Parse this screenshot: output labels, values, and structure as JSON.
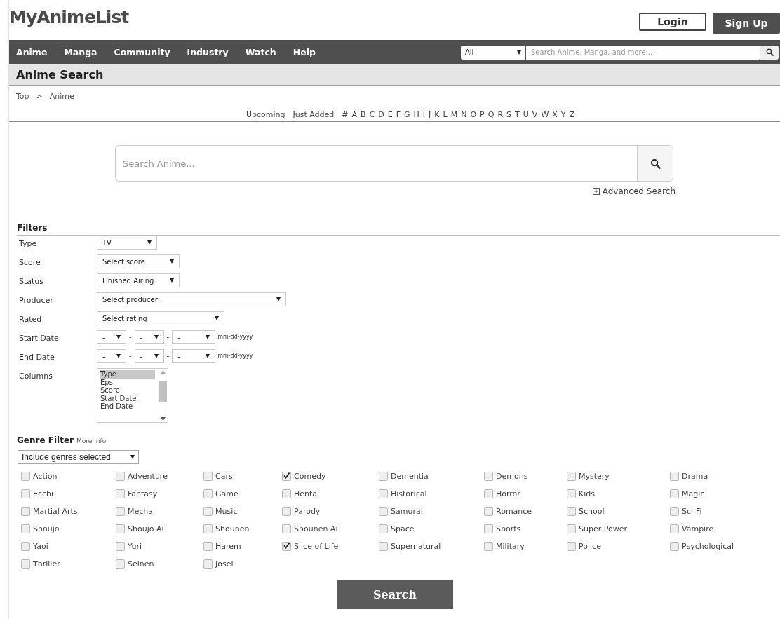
{
  "header": {
    "logo": "MyAnimeList",
    "login": "Login",
    "signup": "Sign Up"
  },
  "nav": {
    "items": [
      "Anime",
      "Manga",
      "Community",
      "Industry",
      "Watch",
      "Help"
    ],
    "search_category": "All",
    "search_placeholder": "Search Anime, Manga, and more..."
  },
  "page_title": "Anime Search",
  "breadcrumb": [
    "Top",
    ">",
    "Anime"
  ],
  "letter_links": [
    "Upcoming",
    "Just Added",
    "#",
    "A",
    "B",
    "C",
    "D",
    "E",
    "F",
    "G",
    "H",
    "I",
    "J",
    "K",
    "L",
    "M",
    "N",
    "O",
    "P",
    "Q",
    "R",
    "S",
    "T",
    "U",
    "V",
    "W",
    "X",
    "Y",
    "Z"
  ],
  "search": {
    "placeholder": "Search Anime...",
    "advanced": "Advanced Search"
  },
  "filters": {
    "title": "Filters",
    "rows": [
      {
        "kind": "select",
        "label": "Type",
        "value": "TV"
      },
      {
        "kind": "select",
        "label": "Score",
        "value": "Select score"
      },
      {
        "kind": "select",
        "label": "Status",
        "value": "Finished Airing"
      },
      {
        "kind": "select",
        "label": "Producer",
        "value": "Select producer"
      },
      {
        "kind": "select",
        "label": "Rated",
        "value": "Select rating"
      },
      {
        "kind": "date",
        "label": "Start Date",
        "parts": [
          "-",
          "-",
          "-"
        ],
        "separator": "-",
        "format": "mm-dd-yyyy"
      },
      {
        "kind": "date",
        "label": "End Date",
        "parts": [
          "-",
          "-",
          "-"
        ],
        "separator": "-",
        "format": "mm-dd-yyyy"
      },
      {
        "kind": "list",
        "label": "Columns",
        "options": [
          {
            "label": "Type",
            "selected": true
          },
          {
            "label": "Eps",
            "selected": false
          },
          {
            "label": "Score",
            "selected": false
          },
          {
            "label": "Start Date",
            "selected": false
          },
          {
            "label": "End Date",
            "selected": false
          }
        ]
      }
    ]
  },
  "genre_filter": {
    "title": "Genre Filter",
    "more_info": "More Info",
    "mode": "Include genres selected",
    "genres": [
      {
        "label": "Action",
        "checked": false
      },
      {
        "label": "Adventure",
        "checked": false
      },
      {
        "label": "Cars",
        "checked": false
      },
      {
        "label": "Comedy",
        "checked": true
      },
      {
        "label": "Dementia",
        "checked": false
      },
      {
        "label": "Demons",
        "checked": false
      },
      {
        "label": "Mystery",
        "checked": false
      },
      {
        "label": "Drama",
        "checked": false
      },
      {
        "label": "Ecchi",
        "checked": false
      },
      {
        "label": "Fantasy",
        "checked": false
      },
      {
        "label": "Game",
        "checked": false
      },
      {
        "label": "Hentai",
        "checked": false
      },
      {
        "label": "Historical",
        "checked": false
      },
      {
        "label": "Horror",
        "checked": false
      },
      {
        "label": "Kids",
        "checked": false
      },
      {
        "label": "Magic",
        "checked": false
      },
      {
        "label": "Martial Arts",
        "checked": false
      },
      {
        "label": "Mecha",
        "checked": false
      },
      {
        "label": "Music",
        "checked": false
      },
      {
        "label": "Parody",
        "checked": false
      },
      {
        "label": "Samurai",
        "checked": false
      },
      {
        "label": "Romance",
        "checked": false
      },
      {
        "label": "School",
        "checked": false
      },
      {
        "label": "Sci-Fi",
        "checked": false
      },
      {
        "label": "Shoujo",
        "checked": false
      },
      {
        "label": "Shoujo Ai",
        "checked": false
      },
      {
        "label": "Shounen",
        "checked": false
      },
      {
        "label": "Shounen Ai",
        "checked": false
      },
      {
        "label": "Space",
        "checked": false
      },
      {
        "label": "Sports",
        "checked": false
      },
      {
        "label": "Super Power",
        "checked": false
      },
      {
        "label": "Vampire",
        "checked": false
      },
      {
        "label": "Yaoi",
        "checked": false
      },
      {
        "label": "Yuri",
        "checked": false
      },
      {
        "label": "Harem",
        "checked": false
      },
      {
        "label": "Slice of Life",
        "checked": true
      },
      {
        "label": "Supernatural",
        "checked": false
      },
      {
        "label": "Military",
        "checked": false
      },
      {
        "label": "Police",
        "checked": false
      },
      {
        "label": "Psychological",
        "checked": false
      },
      {
        "label": "Thriller",
        "checked": false
      },
      {
        "label": "Seinen",
        "checked": false
      },
      {
        "label": "Josei",
        "checked": false
      }
    ],
    "submit": "Search"
  }
}
